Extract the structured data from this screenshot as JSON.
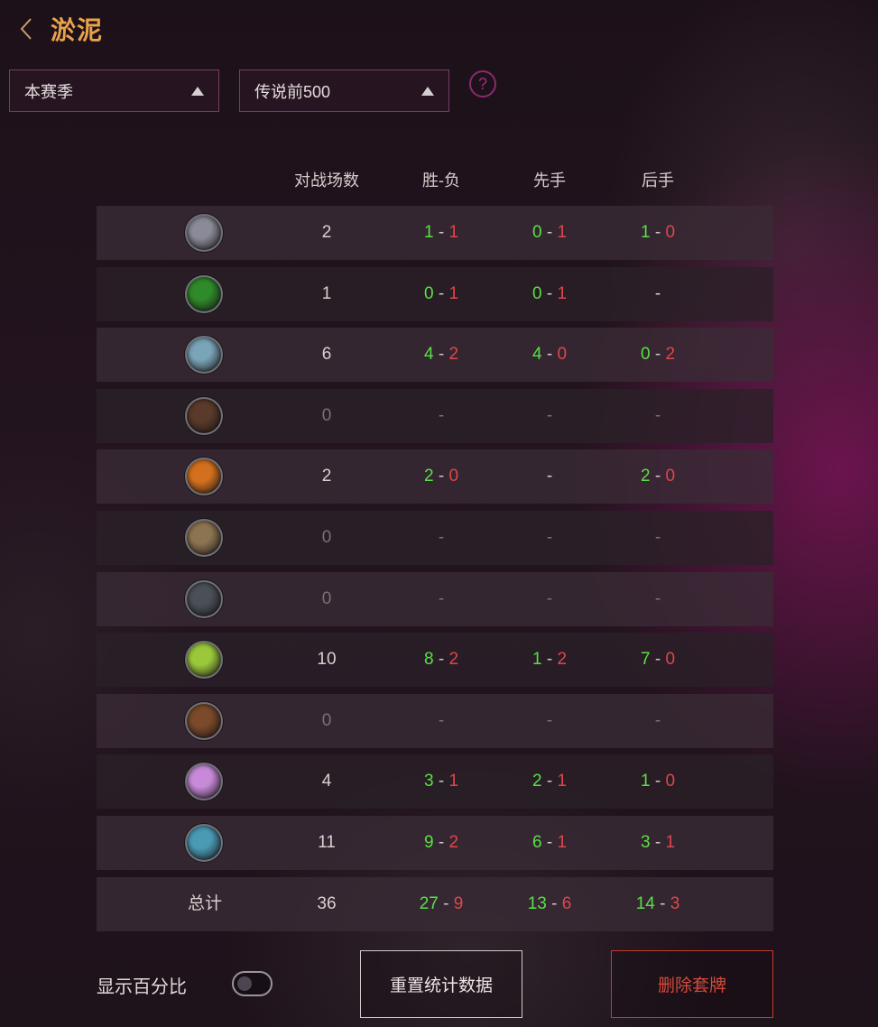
{
  "header": {
    "title": "淤泥"
  },
  "filters": {
    "season": "本赛季",
    "rank": "传说前500"
  },
  "help": {
    "glyph": "?"
  },
  "table": {
    "headers": {
      "games": "对战场数",
      "win_loss": "胜-负",
      "first": "先手",
      "second": "后手"
    },
    "rows": [
      {
        "icon": "warrior-class-icon",
        "color": "#8a8a98",
        "games": "2",
        "wl": [
          "1",
          "1"
        ],
        "first": [
          "0",
          "1"
        ],
        "second": [
          "1",
          "0"
        ]
      },
      {
        "icon": "rogue-class-icon",
        "color": "#2f8a2a",
        "games": "1",
        "wl": [
          "0",
          "1"
        ],
        "first": [
          "0",
          "1"
        ],
        "second": null
      },
      {
        "icon": "shaman-class-icon",
        "color": "#7aa4b8",
        "games": "6",
        "wl": [
          "4",
          "2"
        ],
        "first": [
          "4",
          "0"
        ],
        "second": [
          "0",
          "2"
        ]
      },
      {
        "icon": "hunter-class-icon",
        "color": "#5a3a2a",
        "games": "0",
        "wl": null,
        "first": null,
        "second": null
      },
      {
        "icon": "mage-class-icon",
        "color": "#d2701e",
        "games": "2",
        "wl": [
          "2",
          "0"
        ],
        "first": null,
        "second": [
          "2",
          "0"
        ]
      },
      {
        "icon": "paladin-class-icon",
        "color": "#8c7450",
        "games": "0",
        "wl": null,
        "first": null,
        "second": null
      },
      {
        "icon": "demon-hunter-class-icon",
        "color": "#4a5058",
        "games": "0",
        "wl": null,
        "first": null,
        "second": null
      },
      {
        "icon": "druid-class-icon",
        "color": "#9ac83a",
        "games": "10",
        "wl": [
          "8",
          "2"
        ],
        "first": [
          "1",
          "2"
        ],
        "second": [
          "7",
          "0"
        ]
      },
      {
        "icon": "warlock-class-icon",
        "color": "#7a4a2a",
        "games": "0",
        "wl": null,
        "first": null,
        "second": null
      },
      {
        "icon": "priest-class-icon",
        "color": "#c88ad8",
        "games": "4",
        "wl": [
          "3",
          "1"
        ],
        "first": [
          "2",
          "1"
        ],
        "second": [
          "1",
          "0"
        ]
      },
      {
        "icon": "death-knight-class-icon",
        "color": "#4a9ab4",
        "games": "11",
        "wl": [
          "9",
          "2"
        ],
        "first": [
          "6",
          "1"
        ],
        "second": [
          "3",
          "1"
        ]
      }
    ],
    "total": {
      "label": "总计",
      "games": "36",
      "wl": [
        "27",
        "9"
      ],
      "first": [
        "13",
        "6"
      ],
      "second": [
        "14",
        "3"
      ]
    },
    "empty_mark": "-",
    "separator": "-"
  },
  "footer": {
    "show_percent_label": "显示百分比",
    "show_percent_on": false,
    "reset_label": "重置统计数据",
    "delete_label": "删除套牌"
  },
  "colors": {
    "accent_title": "#e8a24a",
    "win": "#58e046",
    "loss": "#e0464a",
    "delete": "#d64a3a",
    "border": "#7a3a66"
  }
}
